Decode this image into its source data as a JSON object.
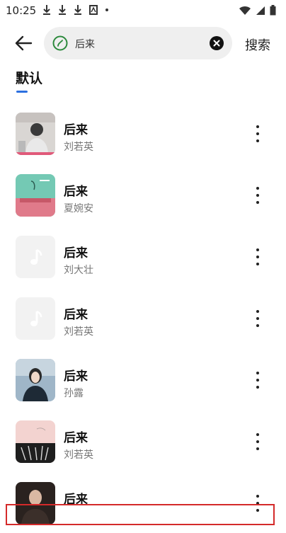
{
  "status": {
    "time": "10:25"
  },
  "search": {
    "query": "后来",
    "button_label": "搜索"
  },
  "tabs": [
    {
      "label": "默认"
    }
  ],
  "songs": [
    {
      "title": "后来",
      "artist": "刘若英",
      "cover": "photo-grey"
    },
    {
      "title": "后来",
      "artist": "夏婉安",
      "cover": "teal-pink"
    },
    {
      "title": "后来",
      "artist": "刘大壮",
      "cover": "placeholder"
    },
    {
      "title": "后来",
      "artist": "刘若英",
      "cover": "placeholder"
    },
    {
      "title": "后来",
      "artist": "孙露",
      "cover": "portrait-blue"
    },
    {
      "title": "后来",
      "artist": "刘若英",
      "cover": "piano-pink"
    },
    {
      "title": "后来",
      "artist": "",
      "cover": "dark"
    }
  ],
  "colors": {
    "accent": "#2b6fe0",
    "highlight": "#d42a2a"
  }
}
